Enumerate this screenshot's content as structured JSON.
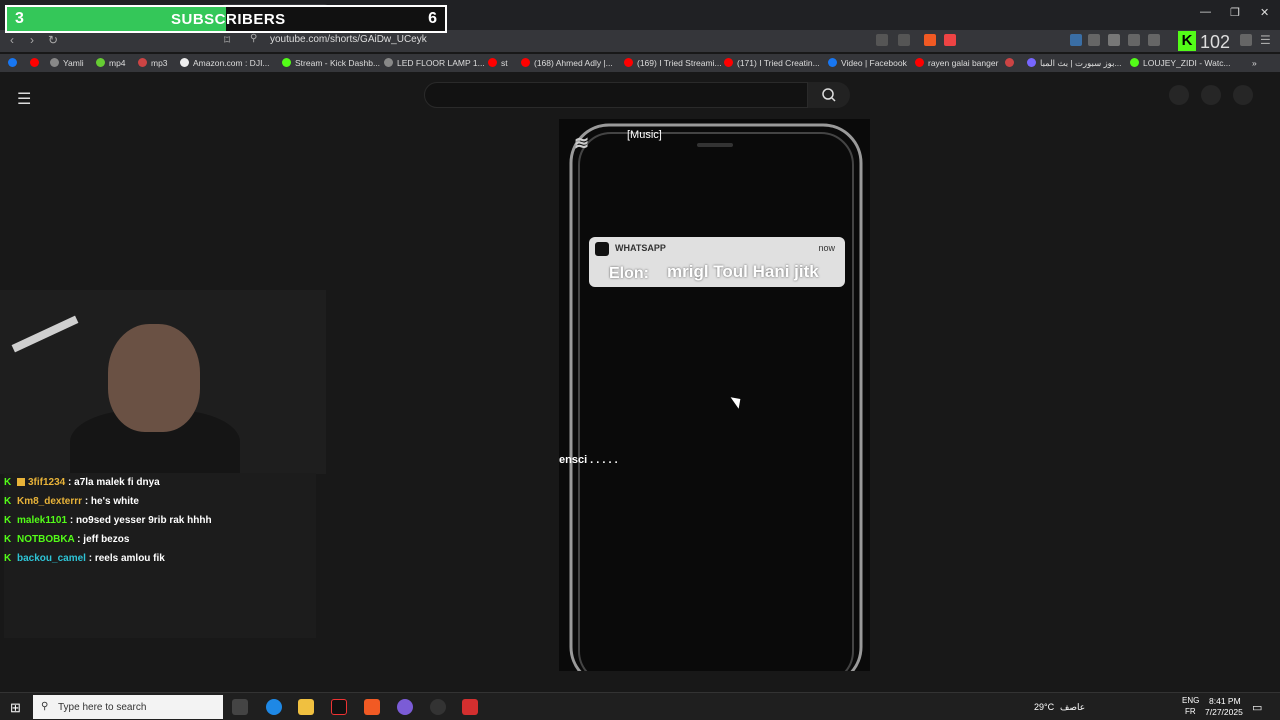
{
  "subscribers": {
    "current": "3",
    "label": "SUBSCRIBERS",
    "goal": "6",
    "progress_fraction": 0.5
  },
  "browser": {
    "tab_close": "×",
    "new_tab": "+",
    "url": "youtube.com/shorts/GAiDw_UCeyk",
    "kick_badge": "K",
    "kick_count": "102",
    "bookmarks": [
      {
        "label": "",
        "color": "#1877f2"
      },
      {
        "label": "",
        "color": "#ff0000"
      },
      {
        "label": "Yamli",
        "color": "#888"
      },
      {
        "label": "mp4",
        "color": "#6c3"
      },
      {
        "label": "mp3",
        "color": "#c44"
      },
      {
        "label": "Amazon.com : DJI...",
        "color": "#eee"
      },
      {
        "label": "Stream - Kick Dashb...",
        "color": "#53fc18"
      },
      {
        "label": "LED FLOOR LAMP 1...",
        "color": "#888"
      },
      {
        "label": "st",
        "color": "#ff0000"
      },
      {
        "label": "(168) Ahmed Adly |...",
        "color": "#ff0000"
      },
      {
        "label": "(169) I Tried Streami...",
        "color": "#ff0000"
      },
      {
        "label": "(171) I Tried Creatin...",
        "color": "#ff0000"
      },
      {
        "label": "Video | Facebook",
        "color": "#1877f2"
      },
      {
        "label": "rayen galai banger",
        "color": "#ff0000"
      },
      {
        "label": "",
        "color": "#c44"
      },
      {
        "label": "بوز سبورت | بث المبا...",
        "color": "#76f"
      },
      {
        "label": "LOUJEY_ZIDI - Watc...",
        "color": "#53fc18"
      }
    ]
  },
  "short": {
    "caption": "[Music]",
    "logo": "≋",
    "notification": {
      "app": "WHATSAPP",
      "time": "now",
      "sender": "Elon:",
      "message": "mrigl Toul Hani jitk"
    },
    "overlay_text": "ensci  . . . . ."
  },
  "chat": [
    {
      "user": "3fif1234",
      "color": "#e8b339",
      "message": " : a7la malek fi dnya",
      "badge": true
    },
    {
      "user": "Km8_dexterrr",
      "color": "#e8b339",
      "message": " : he's white",
      "badge": false
    },
    {
      "user": "malek1101",
      "color": "#53fc18",
      "message": " : no9sed yesser 9rib rak hhhh",
      "badge": false
    },
    {
      "user": "NOTBOBKA",
      "color": "#53fc18",
      "message": " : jeff bezos",
      "badge": false
    },
    {
      "user": "backou_camel",
      "color": "#2ec4d6",
      "message": " : reels amlou fik",
      "badge": false
    }
  ],
  "taskbar": {
    "search_placeholder": "Type here to search",
    "weather": "29°C",
    "weather_desc": "عاصف",
    "lang1": "ENG",
    "lang2": "FR",
    "time": "8:41 PM",
    "date": "7/27/2025"
  }
}
